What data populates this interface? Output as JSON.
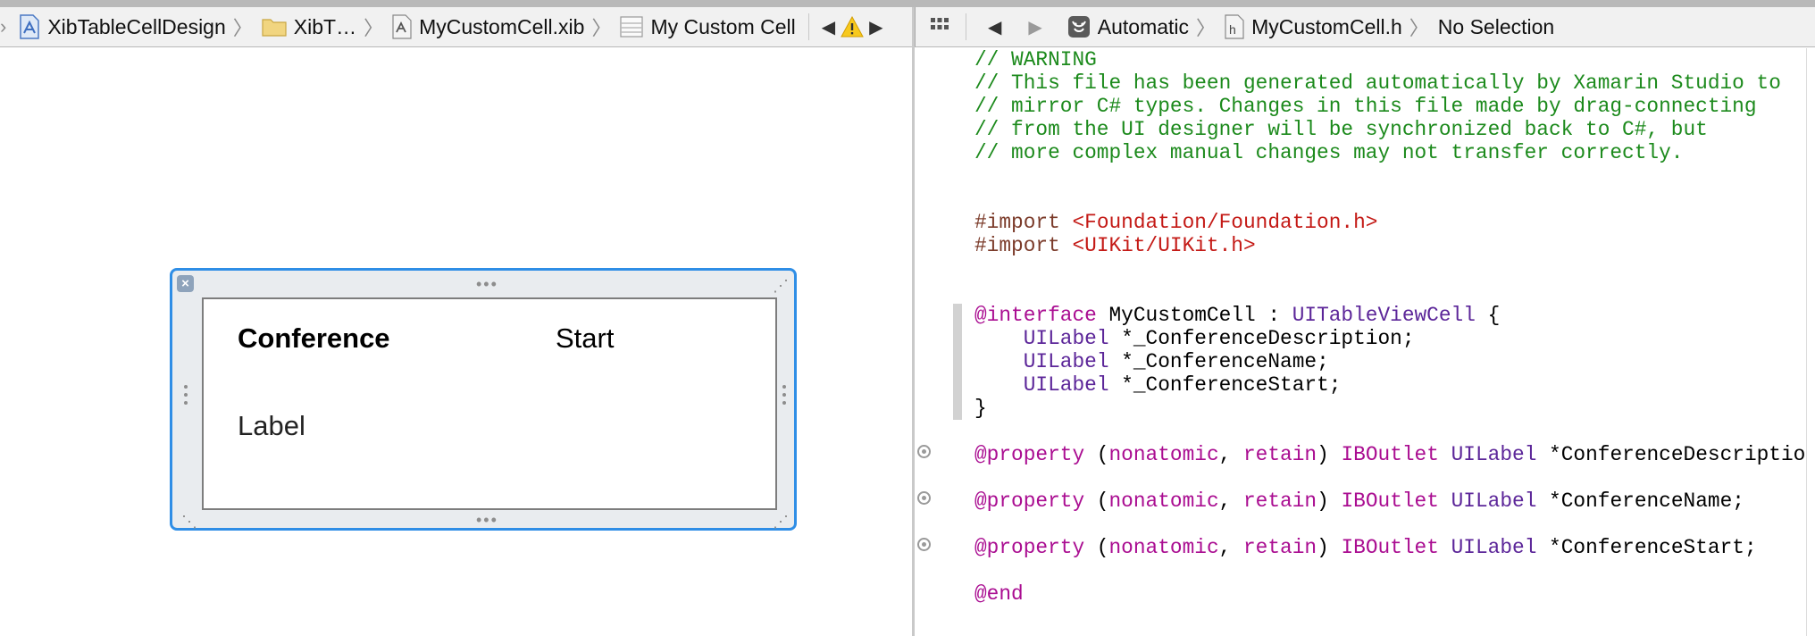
{
  "left_jumpbar": {
    "crumbs": [
      {
        "label": "XibTableCellDesign",
        "icon": "project-icon"
      },
      {
        "label": "XibT…",
        "icon": "folder-icon"
      },
      {
        "label": "MyCustomCell.xib",
        "icon": "xib-file-icon"
      },
      {
        "label": "My Custom Cell",
        "icon": "table-cell-icon"
      }
    ],
    "warning_icon": "warning-icon"
  },
  "right_jumpbar": {
    "crumbs": [
      {
        "label": "Automatic",
        "icon": "automatic-icon"
      },
      {
        "label": "MyCustomCell.h",
        "icon": "header-file-icon"
      },
      {
        "label": "No Selection"
      }
    ]
  },
  "cell": {
    "conference_label": "Conference",
    "start_label": "Start",
    "description_label": "Label"
  },
  "code": {
    "lines": [
      [
        {
          "t": "// WARNING",
          "c": "comment"
        }
      ],
      [
        {
          "t": "// This file has been generated automatically by Xamarin Studio to",
          "c": "comment"
        }
      ],
      [
        {
          "t": "// mirror C# types. Changes in this file made by drag-connecting",
          "c": "comment"
        }
      ],
      [
        {
          "t": "// from the UI designer will be synchronized back to C#, but",
          "c": "comment"
        }
      ],
      [
        {
          "t": "// more complex manual changes may not transfer correctly.",
          "c": "comment"
        }
      ],
      [],
      [],
      [
        {
          "t": "#import ",
          "c": "pre"
        },
        {
          "t": "<Foundation/Foundation.h>",
          "c": "str"
        }
      ],
      [
        {
          "t": "#import ",
          "c": "pre"
        },
        {
          "t": "<UIKit/UIKit.h>",
          "c": "str"
        }
      ],
      [],
      [],
      [
        {
          "t": "@interface",
          "c": "kw"
        },
        {
          "t": " MyCustomCell : ",
          "c": "plain"
        },
        {
          "t": "UITableViewCell",
          "c": "type"
        },
        {
          "t": " {",
          "c": "plain"
        }
      ],
      [
        {
          "t": "    ",
          "c": "plain"
        },
        {
          "t": "UILabel",
          "c": "type"
        },
        {
          "t": " *_ConferenceDescription;",
          "c": "plain"
        }
      ],
      [
        {
          "t": "    ",
          "c": "plain"
        },
        {
          "t": "UILabel",
          "c": "type"
        },
        {
          "t": " *_ConferenceName;",
          "c": "plain"
        }
      ],
      [
        {
          "t": "    ",
          "c": "plain"
        },
        {
          "t": "UILabel",
          "c": "type"
        },
        {
          "t": " *_ConferenceStart;",
          "c": "plain"
        }
      ],
      [
        {
          "t": "}",
          "c": "plain"
        }
      ],
      [],
      [
        {
          "t": "@property",
          "c": "kw"
        },
        {
          "t": " (",
          "c": "plain"
        },
        {
          "t": "nonatomic",
          "c": "kw"
        },
        {
          "t": ", ",
          "c": "plain"
        },
        {
          "t": "retain",
          "c": "kw"
        },
        {
          "t": ") ",
          "c": "plain"
        },
        {
          "t": "IBOutlet",
          "c": "kw"
        },
        {
          "t": " ",
          "c": "plain"
        },
        {
          "t": "UILabel",
          "c": "type"
        },
        {
          "t": " *ConferenceDescription;",
          "c": "plain"
        }
      ],
      [],
      [
        {
          "t": "@property",
          "c": "kw"
        },
        {
          "t": " (",
          "c": "plain"
        },
        {
          "t": "nonatomic",
          "c": "kw"
        },
        {
          "t": ", ",
          "c": "plain"
        },
        {
          "t": "retain",
          "c": "kw"
        },
        {
          "t": ") ",
          "c": "plain"
        },
        {
          "t": "IBOutlet",
          "c": "kw"
        },
        {
          "t": " ",
          "c": "plain"
        },
        {
          "t": "UILabel",
          "c": "type"
        },
        {
          "t": " *ConferenceName;",
          "c": "plain"
        }
      ],
      [],
      [
        {
          "t": "@property",
          "c": "kw"
        },
        {
          "t": " (",
          "c": "plain"
        },
        {
          "t": "nonatomic",
          "c": "kw"
        },
        {
          "t": ", ",
          "c": "plain"
        },
        {
          "t": "retain",
          "c": "kw"
        },
        {
          "t": ") ",
          "c": "plain"
        },
        {
          "t": "IBOutlet",
          "c": "kw"
        },
        {
          "t": " ",
          "c": "plain"
        },
        {
          "t": "UILabel",
          "c": "type"
        },
        {
          "t": " *ConferenceStart;",
          "c": "plain"
        }
      ],
      [],
      [
        {
          "t": "@end",
          "c": "kw"
        }
      ]
    ]
  },
  "colors": {
    "selection_blue": "#2f8ee6",
    "comment_green": "#1c8a1c",
    "keyword_purple": "#aa0d91",
    "type_purple": "#5c2699",
    "string_red": "#c41a16"
  }
}
